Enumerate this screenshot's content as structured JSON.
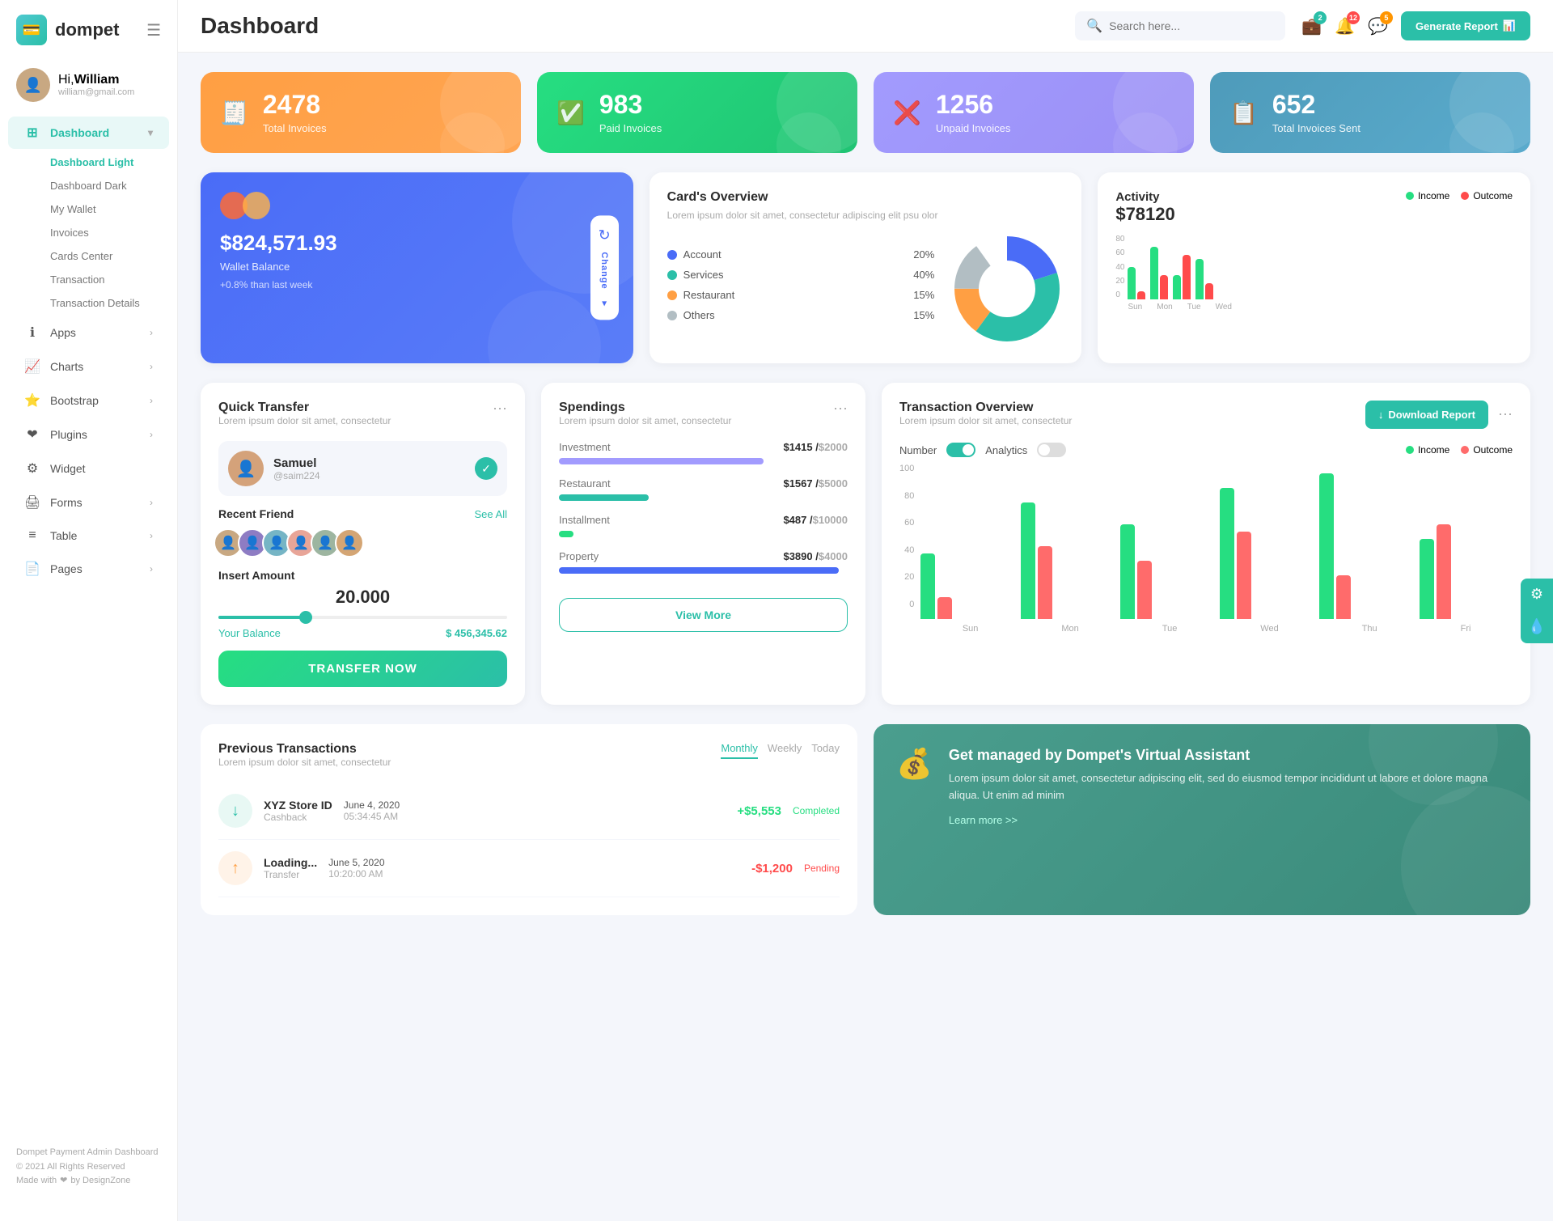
{
  "logo": {
    "text": "dompet",
    "icon": "💳"
  },
  "user": {
    "hi": "Hi,",
    "name": "William",
    "email": "william@gmail.com"
  },
  "topbar": {
    "title": "Dashboard",
    "search_placeholder": "Search here...",
    "generate_btn": "Generate Report",
    "notifications": {
      "wallet": "2",
      "bell": "12",
      "chat": "5"
    }
  },
  "stat_cards": [
    {
      "number": "2478",
      "label": "Total Invoices",
      "color": "orange",
      "icon": "🧾"
    },
    {
      "number": "983",
      "label": "Paid Invoices",
      "color": "green",
      "icon": "✅"
    },
    {
      "number": "1256",
      "label": "Unpaid Invoices",
      "color": "purple",
      "icon": "❌"
    },
    {
      "number": "652",
      "label": "Total Invoices Sent",
      "color": "teal",
      "icon": "📋"
    }
  ],
  "wallet": {
    "balance": "$824,571.93",
    "label": "Wallet Balance",
    "change": "+0.8% than last week",
    "change_btn": "Change"
  },
  "cards_overview": {
    "title": "Card's Overview",
    "desc": "Lorem ipsum dolor sit amet, consectetur adipiscing elit psu olor",
    "items": [
      {
        "label": "Account",
        "pct": "20%",
        "color": "#4a6cf7"
      },
      {
        "label": "Services",
        "pct": "40%",
        "color": "#2bbfa8"
      },
      {
        "label": "Restaurant",
        "pct": "15%",
        "color": "#ff9f43"
      },
      {
        "label": "Others",
        "pct": "15%",
        "color": "#b2bec3"
      }
    ]
  },
  "activity": {
    "title": "Activity",
    "amount": "$78120",
    "legend": [
      {
        "label": "Income",
        "color": "#26de81"
      },
      {
        "label": "Outcome",
        "color": "#ff4b4b"
      }
    ],
    "days": [
      "Sun",
      "Mon",
      "Tue",
      "Wed"
    ],
    "bars": [
      {
        "income": 40,
        "outcome": 10
      },
      {
        "income": 65,
        "outcome": 30
      },
      {
        "income": 30,
        "outcome": 55
      },
      {
        "income": 50,
        "outcome": 20
      }
    ],
    "y_labels": [
      "80",
      "60",
      "40",
      "20",
      "0"
    ]
  },
  "quick_transfer": {
    "title": "Quick Transfer",
    "desc": "Lorem ipsum dolor sit amet, consectetur",
    "user": {
      "name": "Samuel",
      "id": "@saim224"
    },
    "recent_label": "Recent Friend",
    "see_all": "See All",
    "friends": [
      "#c8a882",
      "#8e7cc3",
      "#76b5c5",
      "#e8a598",
      "#9db5a0",
      "#d4a574"
    ],
    "insert_label": "Insert Amount",
    "amount": "20.000",
    "balance_label": "Your Balance",
    "balance_val": "$ 456,345.62",
    "transfer_btn": "TRANSFER NOW"
  },
  "spendings": {
    "title": "Spendings",
    "desc": "Lorem ipsum dolor sit amet, consectetur",
    "items": [
      {
        "label": "Investment",
        "amount": "$1415",
        "total": "$2000",
        "pct": 71,
        "color": "#a29bfe"
      },
      {
        "label": "Restaurant",
        "amount": "$1567",
        "total": "$5000",
        "pct": 31,
        "color": "#2bbfa8"
      },
      {
        "label": "Installment",
        "amount": "$487",
        "total": "$10000",
        "pct": 5,
        "color": "#26de81"
      },
      {
        "label": "Property",
        "amount": "$3890",
        "total": "$4000",
        "pct": 97,
        "color": "#4a6cf7"
      }
    ],
    "view_more": "View More"
  },
  "transaction_overview": {
    "title": "Transaction Overview",
    "desc": "Lorem ipsum dolor sit amet, consectetur",
    "download_btn": "Download Report",
    "toggles": [
      {
        "label": "Number",
        "on": true
      },
      {
        "label": "Analytics",
        "on": false
      }
    ],
    "legend": [
      {
        "label": "Income",
        "color": "#26de81"
      },
      {
        "label": "Outcome",
        "color": "#ff6b6b"
      }
    ],
    "days": [
      "Sun",
      "Mon",
      "Tue",
      "Wed",
      "Thu",
      "Fri"
    ],
    "bars": [
      {
        "income": 45,
        "outcome": 15
      },
      {
        "income": 80,
        "outcome": 50
      },
      {
        "income": 65,
        "outcome": 40
      },
      {
        "income": 90,
        "outcome": 60
      },
      {
        "income": 100,
        "outcome": 30
      },
      {
        "income": 55,
        "outcome": 65
      }
    ],
    "y_labels": [
      "100",
      "80",
      "60",
      "40",
      "20",
      "0"
    ]
  },
  "prev_transactions": {
    "title": "Previous Transactions",
    "desc": "Lorem ipsum dolor sit amet, consectetur",
    "tabs": [
      "Monthly",
      "Weekly",
      "Today"
    ],
    "active_tab": "Monthly",
    "rows": [
      {
        "name": "XYZ Store ID",
        "type": "Cashback",
        "date": "June 4, 2020",
        "time": "05:34:45 AM",
        "amount": "+$5,553",
        "status": "Completed"
      }
    ]
  },
  "virtual_assistant": {
    "title": "Get managed by Dompet's Virtual Assistant",
    "desc": "Lorem ipsum dolor sit amet, consectetur adipiscing elit, sed do eiusmod tempor incididunt ut labore et dolore magna aliqua. Ut enim ad minim",
    "link": "Learn more >>",
    "icon": "💰"
  },
  "sidebar": {
    "nav_items": [
      {
        "label": "Dashboard",
        "icon": "⊞",
        "active": true,
        "has_sub": true
      },
      {
        "label": "Apps",
        "icon": "ℹ",
        "active": false,
        "has_sub": true
      },
      {
        "label": "Charts",
        "icon": "📈",
        "active": false,
        "has_sub": true
      },
      {
        "label": "Bootstrap",
        "icon": "⭐",
        "active": false,
        "has_sub": true
      },
      {
        "label": "Plugins",
        "icon": "❤",
        "active": false,
        "has_sub": true
      },
      {
        "label": "Widget",
        "icon": "⚙",
        "active": false,
        "has_sub": false
      },
      {
        "label": "Forms",
        "icon": "🖨",
        "active": false,
        "has_sub": true
      },
      {
        "label": "Table",
        "icon": "≡",
        "active": false,
        "has_sub": true
      },
      {
        "label": "Pages",
        "icon": "📄",
        "active": false,
        "has_sub": true
      }
    ],
    "sub_items": [
      "Dashboard Light",
      "Dashboard Dark",
      "My Wallet",
      "Invoices",
      "Cards Center",
      "Transaction",
      "Transaction Details"
    ],
    "footer": {
      "brand": "Dompet Payment Admin Dashboard",
      "copyright": "© 2021 All Rights Reserved",
      "made_with": "Made with",
      "heart": "❤",
      "by": "by DesignZone"
    }
  }
}
